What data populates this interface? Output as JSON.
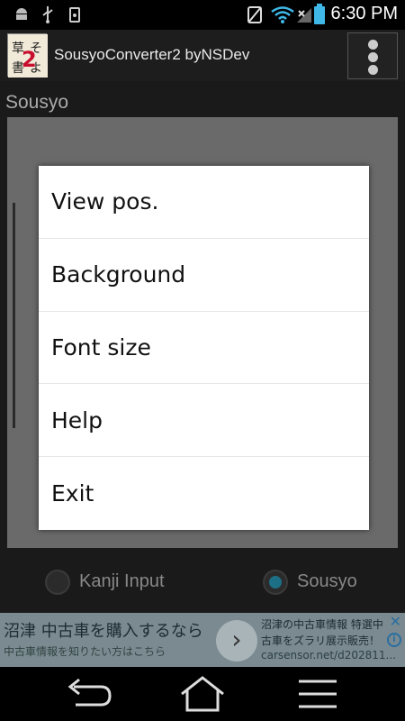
{
  "status_bar": {
    "time": "6:30 PM",
    "icons": [
      "android-icon",
      "usb-icon",
      "battery-saver-icon",
      "no-sim-icon",
      "wifi-icon",
      "signal-icon",
      "battery-icon"
    ]
  },
  "action_bar": {
    "app_icon": "app-icon",
    "title": "SousyoConverter2 byNSDev",
    "overflow_icon": "more-vert-icon"
  },
  "content": {
    "section_label": "Sousyo",
    "radio_options": [
      {
        "label": "Kanji Input",
        "checked": false
      },
      {
        "label": "Sousyo",
        "checked": true
      }
    ]
  },
  "ad": {
    "title": "沼津 中古車を購入するなら",
    "subtitle": "中古車情報を知りたい方はこちら",
    "right_line1": "沼津の中古車情報 特選中",
    "right_line2": "古車をズラリ展示販売！",
    "right_line3": "carsensor.net/d202811...",
    "close_icon": "close-icon",
    "info_icon": "info-icon"
  },
  "popup_menu": {
    "items": [
      "View pos.",
      "Background",
      "Font size",
      "Help",
      "Exit"
    ]
  },
  "nav_bar": {
    "icons": [
      "back-icon",
      "home-icon",
      "menu-icon"
    ]
  },
  "colors": {
    "accent": "#1d6f86",
    "popup_bg": "#ffffff",
    "ad_bg": "#7a8a90"
  }
}
